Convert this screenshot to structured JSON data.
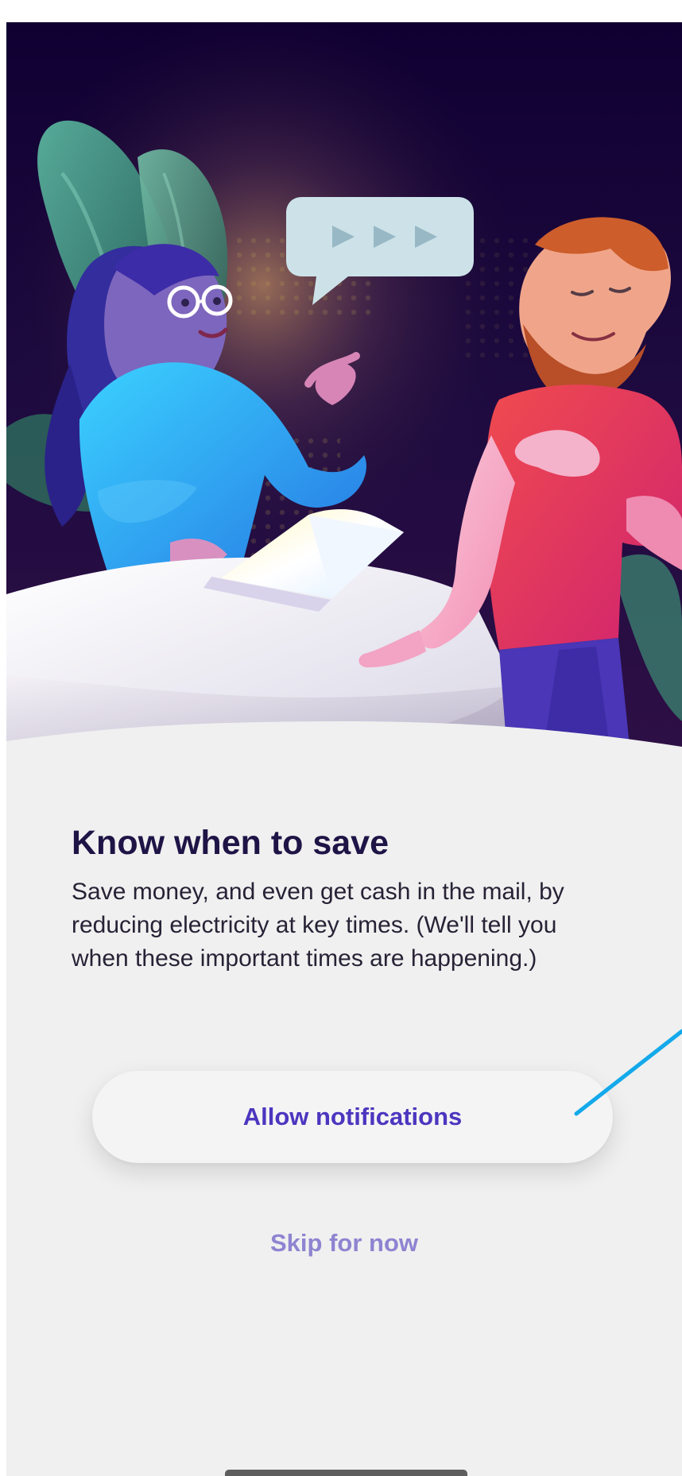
{
  "screen": {
    "title": "Know when to save",
    "body": "Save money, and even get cash in the mail, by reducing electricity at key times. (We'll tell you when these important times are happening.)"
  },
  "actions": {
    "allow_notifications": "Allow notifications",
    "skip": "Skip for now"
  },
  "illustration": {
    "subject": "two people talking beside a laptop with a speech bubble",
    "speech_bubble_icon": "play-arrows-icon"
  },
  "colors": {
    "accent": "#4c36bf",
    "secondary_accent": "#8e84d1",
    "title": "#1f1446",
    "text": "#282236",
    "background": "#f0f0f0",
    "annotation_line": "#13a9ea"
  }
}
